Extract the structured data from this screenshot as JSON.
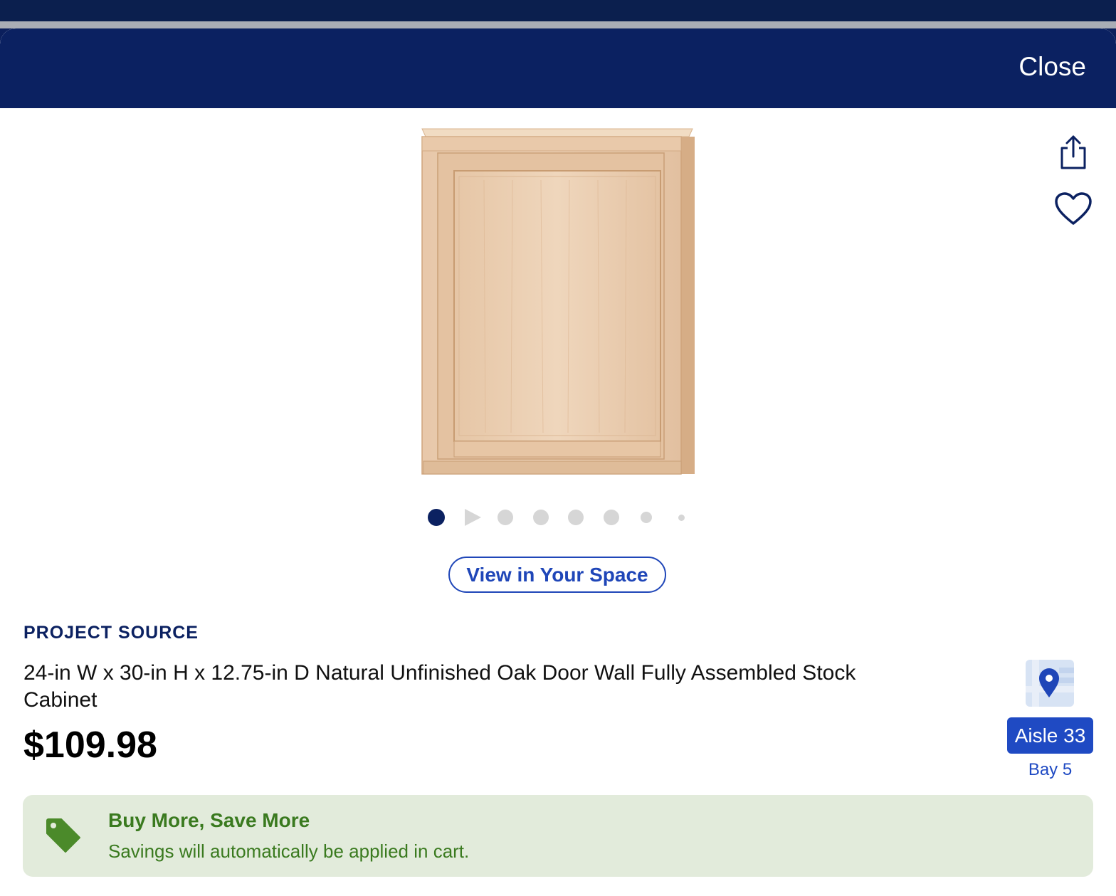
{
  "header": {
    "close_label": "Close"
  },
  "product": {
    "brand": "PROJECT SOURCE",
    "title": "24-in W x 30-in H x 12.75-in D Natural Unfinished Oak Door Wall Fully Assembled Stock Cabinet",
    "price": "$109.98"
  },
  "gallery": {
    "image_count": 8,
    "active_index": 0,
    "video_index": 1,
    "view_in_space_label": "View in Your Space"
  },
  "location": {
    "aisle": "Aisle 33",
    "bay": "Bay 5"
  },
  "promo": {
    "title": "Buy More, Save More",
    "subtitle": "Savings will automatically be applied in cart."
  },
  "icons": {
    "share": "share-icon",
    "favorite": "heart-icon",
    "map": "map-pin-icon",
    "tag": "price-tag-icon",
    "play": "play-icon"
  },
  "colors": {
    "header_bg": "#0b2161",
    "link_blue": "#1f46b8",
    "aisle_blue": "#1f4ac3",
    "promo_bg": "#e2ebdb",
    "promo_green": "#3a7a1f",
    "active_dot": "#0b2161",
    "inactive_dot": "#d6d6d6"
  }
}
